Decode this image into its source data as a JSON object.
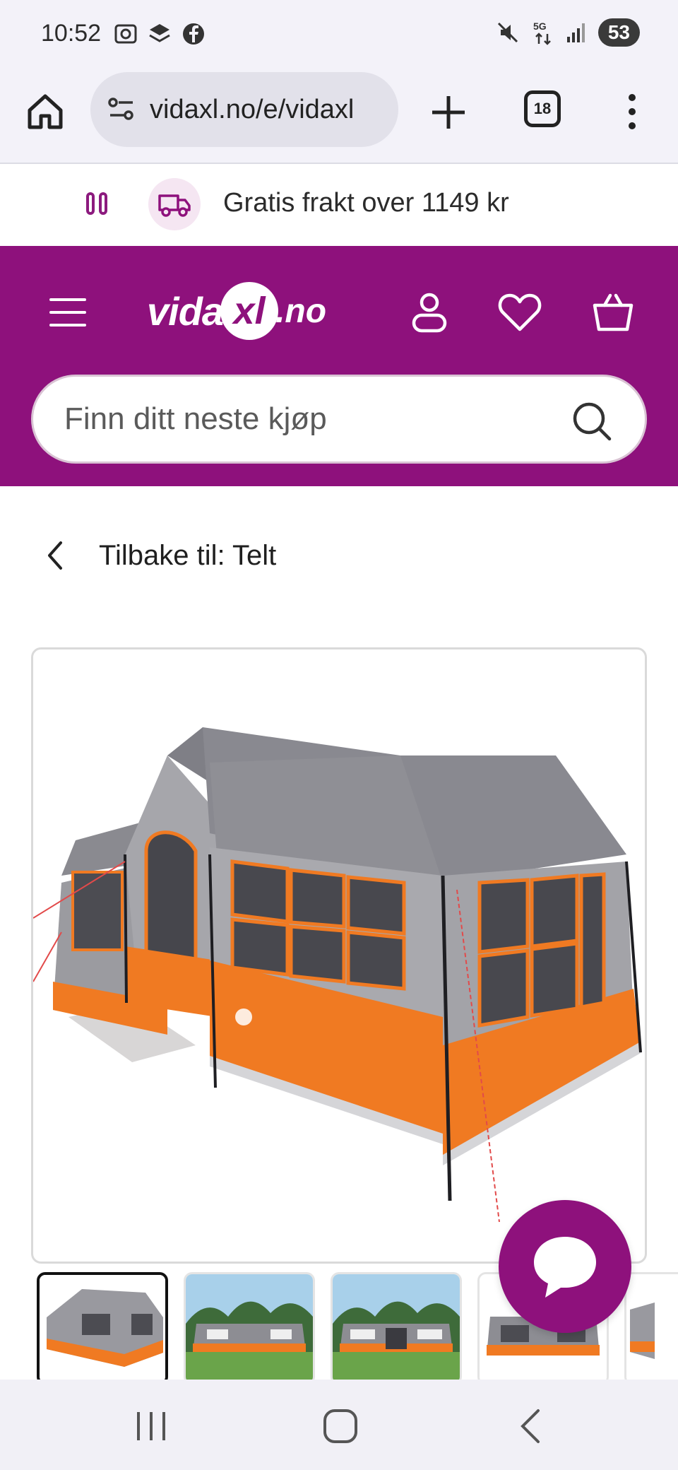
{
  "status_bar": {
    "time": "10:52",
    "battery": "53",
    "network": "5G"
  },
  "browser": {
    "url": "vidaxl.no/e/vidaxl",
    "tab_count": "18"
  },
  "promo": {
    "text": "Gratis frakt over 1149 kr"
  },
  "header": {
    "logo_part1": "vida",
    "logo_xl": "xl",
    "logo_part2": ".no",
    "search_placeholder": "Finn ditt neste kjøp"
  },
  "breadcrumb": {
    "back_label": "Tilbake til: Telt"
  },
  "product": {
    "image_alt": "Orange and grey cabin tent",
    "thumbnail_count": 5
  },
  "colors": {
    "brand_purple": "#8e117c",
    "tent_orange": "#f07a22",
    "tent_grey": "#8f8f95"
  }
}
